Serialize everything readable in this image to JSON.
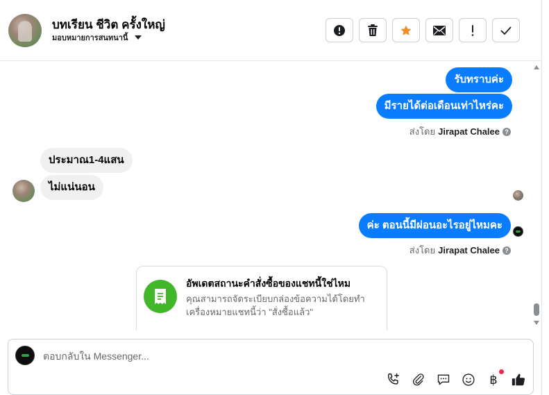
{
  "header": {
    "contact_name": "บทเรียน ชีวิต ครั้งใหญ่",
    "assign_label": "มอบหมายการสนทนานี้",
    "toolbar": [
      {
        "icon": "alert-circle-icon"
      },
      {
        "icon": "trash-icon"
      },
      {
        "icon": "star-icon"
      },
      {
        "icon": "envelope-icon"
      },
      {
        "icon": "exclamation-icon"
      },
      {
        "icon": "check-icon"
      }
    ]
  },
  "messages": [
    {
      "direction": "out",
      "text": "รับทราบค่ะ"
    },
    {
      "direction": "out",
      "text": "มีรายได้ต่อเดือนเท่าไหร่คะ"
    },
    {
      "direction": "meta",
      "sent_by_prefix": "ส่งโดย",
      "sent_by_name": "Jirapat Chalee"
    },
    {
      "direction": "in",
      "text": "ประมาณ1-4แสน"
    },
    {
      "direction": "in",
      "text": "ไม่แน่นอน"
    },
    {
      "direction": "out",
      "text": "ค่ะ ตอนนี้มีผ่อนอะไรอยู่ไหมคะ"
    },
    {
      "direction": "meta",
      "sent_by_prefix": "ส่งโดย",
      "sent_by_name": "Jirapat Chalee"
    }
  ],
  "help_mark": "?",
  "order_card": {
    "title": "อัพเดตสถานะคำสั่งซื้อของแชทนี้ใช่ไหม",
    "description": "คุณสามารถจัดระเบียบกล่องข้อความได้โดยทำเครื่องหมายแชทนี้ว่า \"สั่งซื้อแล้ว\""
  },
  "composer": {
    "placeholder": "ตอบกลับใน Messenger...",
    "tools": [
      "phone-plus-icon",
      "paperclip-icon",
      "chat-bubble-icon",
      "emoji-icon",
      "baht-icon",
      "thumbs-up-icon"
    ],
    "baht_symbol": "฿"
  },
  "colors": {
    "outgoing_bubble": "#0a7cff",
    "incoming_bubble": "#f0f0f0",
    "star": "#f08c2a",
    "order_icon_bg": "#42b72a",
    "notification_dot": "#f02849"
  }
}
